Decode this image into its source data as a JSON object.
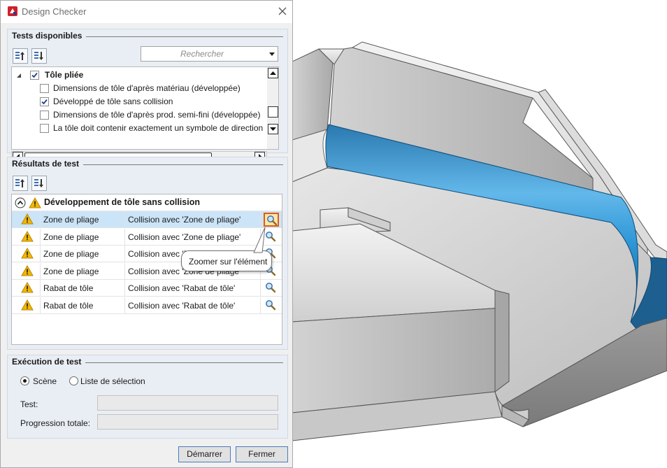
{
  "window": {
    "title": "Design Checker"
  },
  "tests_group": {
    "title": "Tests disponibles",
    "search_placeholder": "Rechercher",
    "tree": {
      "category": {
        "label": "Tôle pliée",
        "checked": true
      },
      "items": [
        {
          "label": "Dimensions de tôle d'après matériau (développée)",
          "checked": false
        },
        {
          "label": "Développé de tôle sans collision",
          "checked": true
        },
        {
          "label": "Dimensions de tôle d'après prod. semi-fini (développée)",
          "checked": false
        },
        {
          "label": "La tôle doit contenir exactement un symbole de direction",
          "checked": false
        }
      ]
    }
  },
  "results_group": {
    "title": "Résultats de test",
    "header": "Développement de tôle sans collision",
    "rows": [
      {
        "element": "Zone de pliage",
        "message": "Collision avec 'Zone de pliage'",
        "selected": true
      },
      {
        "element": "Zone de pliage",
        "message": "Collision avec 'Zone de pliage'",
        "selected": false
      },
      {
        "element": "Zone de pliage",
        "message": "Collision avec 'Zone de pliage'",
        "selected": false
      },
      {
        "element": "Zone de pliage",
        "message": "Collision avec 'Zone de pliage'",
        "selected": false
      },
      {
        "element": "Rabat de tôle",
        "message": "Collision avec 'Rabat de tôle'",
        "selected": false
      },
      {
        "element": "Rabat de tôle",
        "message": "Collision avec 'Rabat de tôle'",
        "selected": false
      }
    ],
    "tooltip": "Zoomer sur l'élément"
  },
  "execution_group": {
    "title": "Exécution de test",
    "radio_scene": "Scène",
    "radio_selection": "Liste de sélection",
    "selected_radio": "Scène",
    "test_label": "Test:",
    "progress_label": "Progression totale:"
  },
  "buttons": {
    "start": "Démarrer",
    "close": "Fermer"
  },
  "colors": {
    "accent": "#4a7ac0",
    "highlight_blue": "#1e86c8",
    "warning": "#f2b705",
    "zoom_active_border": "#e05a1a"
  },
  "icons": [
    "app-logo-icon",
    "close-icon",
    "move-up-icon",
    "move-down-icon",
    "expand-collapse-icon",
    "warning-icon",
    "zoom-magnifier-icon",
    "dropdown-arrow-icon"
  ]
}
